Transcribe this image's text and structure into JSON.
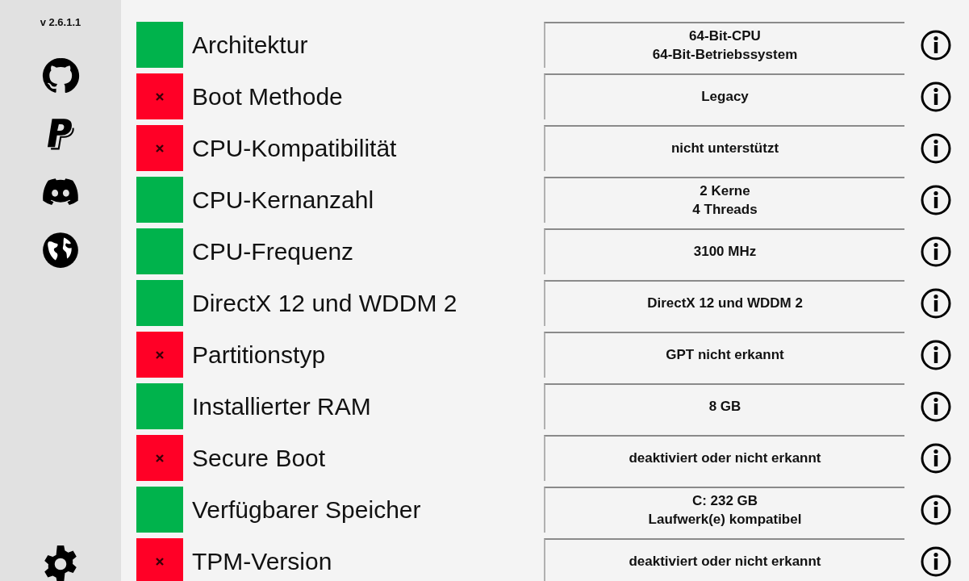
{
  "sidebar": {
    "version": "v 2.6.1.1"
  },
  "checks": [
    {
      "label": "Architektur",
      "passed": true,
      "value": [
        "64-Bit-CPU",
        "64-Bit-Betriebssystem"
      ]
    },
    {
      "label": "Boot Methode",
      "passed": false,
      "value": [
        "Legacy"
      ]
    },
    {
      "label": "CPU-Kompatibilität",
      "passed": false,
      "value": [
        "nicht unterstützt"
      ]
    },
    {
      "label": "CPU-Kernanzahl",
      "passed": true,
      "value": [
        "2 Kerne",
        "4 Threads"
      ]
    },
    {
      "label": "CPU-Frequenz",
      "passed": true,
      "value": [
        "3100 MHz"
      ]
    },
    {
      "label": "DirectX 12 und WDDM 2",
      "passed": true,
      "value": [
        "DirectX 12 und WDDM 2"
      ]
    },
    {
      "label": "Partitionstyp",
      "passed": false,
      "value": [
        "GPT nicht erkannt"
      ]
    },
    {
      "label": "Installierter RAM",
      "passed": true,
      "value": [
        "8 GB"
      ]
    },
    {
      "label": "Secure Boot",
      "passed": false,
      "value": [
        "deaktiviert oder nicht erkannt"
      ]
    },
    {
      "label": "Verfügbarer Speicher",
      "passed": true,
      "value": [
        "C: 232 GB",
        "Laufwerk(e) kompatibel"
      ]
    },
    {
      "label": "TPM-Version",
      "passed": false,
      "value": [
        "deaktiviert oder nicht erkannt"
      ]
    }
  ]
}
